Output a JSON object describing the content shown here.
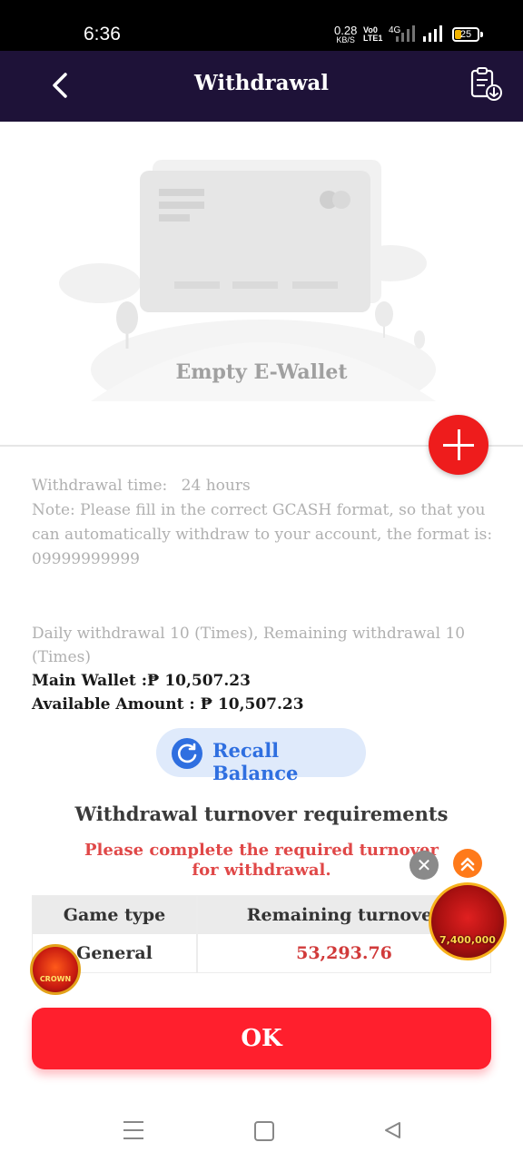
{
  "status_bar": {
    "time": "6:36",
    "net_speed": "0.28",
    "net_unit": "KB/S",
    "volte_top": "Vo0",
    "volte_bottom": "LTE1",
    "network": "4G",
    "battery": "25"
  },
  "header": {
    "title": "Withdrawal",
    "back_icon": "chevron-left-icon",
    "record_icon": "clipboard-download-icon"
  },
  "empty_state": {
    "text": "Empty E-Wallet"
  },
  "info": {
    "withdrawal_time_label": "Withdrawal time:",
    "withdrawal_time_value": "24 hours",
    "note": "Note: Please fill in the correct GCASH format, so that you can automatically withdraw to your account, the format is: 09999999999",
    "daily": "Daily withdrawal 10 (Times), Remaining withdrawal 10 (Times)",
    "main_wallet": "Main Wallet :₱ 10,507.23",
    "available_amount": "Available Amount : ₱ 10,507.23"
  },
  "recall": {
    "label": "Recall Balance"
  },
  "turnover": {
    "title": "Withdrawal turnover requirements",
    "note": "Please complete the required turnover for withdrawal.",
    "columns": [
      "Game type",
      "Remaining turnover"
    ],
    "rows": [
      {
        "game_type": "General",
        "remaining": "53,293.76"
      }
    ]
  },
  "promo": {
    "right_amount": "7,400,000",
    "left_label": "CROWN"
  },
  "ok_label": "OK",
  "colors": {
    "header_bg": "#1e1238",
    "accent_red": "#ff1f2d",
    "recall_blue": "#2f6fe0",
    "warning_red": "#e04848",
    "turnover_value": "#d13a3a"
  }
}
